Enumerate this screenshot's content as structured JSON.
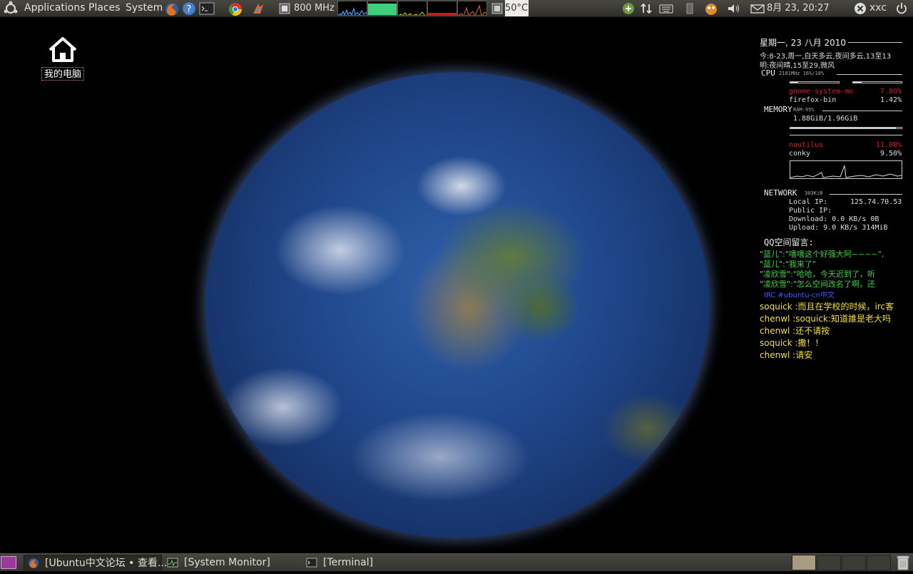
{
  "top_panel": {
    "applications": "Applications",
    "places": "Places",
    "system": "System",
    "cpu_freq": "800 MHz",
    "temperature": "50°C",
    "datetime": "8月 23, 20:27",
    "username": "xxc"
  },
  "desktop": {
    "home_label": "我的电脑"
  },
  "conky": {
    "date": "星期一, 23 八月 2010",
    "weather_line1": "今:8-23,周一,白天多云,夜间多云,13至13",
    "weather_line2": "明:夜间晴,15至29,微风",
    "cpu_label": "CPU",
    "cpu_info": "2101MHz 16%/18%",
    "cpu_procs": [
      {
        "name": "gnome-system-mo",
        "value": "7.80%"
      },
      {
        "name": "firefox-bin",
        "value": "1.42%"
      }
    ],
    "memory_label": "MEMORY",
    "ram_info": "RAM:95%",
    "mem_usage": "1.88GiB/1.96GiB",
    "ram_fraction": 0.95,
    "mem_procs": [
      {
        "name": "nautilus",
        "value": "11.08%"
      },
      {
        "name": "conky",
        "value": "9.50%"
      }
    ],
    "network_label": "NETWORK",
    "network_info": "303KiB",
    "local_ip_label": "Local IP:",
    "local_ip": "125.74.70.53",
    "public_ip_label": "Public IP:",
    "download": "Download: 0.0 KB/s     0B",
    "upload": "Upload: 9.0 KB/s  314MiB",
    "qq_title": "QQ空间留言:",
    "qq_messages": [
      "\"蓝儿\":\"嘻嘻这个好强大阿~~~~\",",
      "\"蓝儿\":\"我来了\"",
      "\"凌欣雪\":\"哈哈，今天迟到了，听",
      "\"凌欣雪\":\"怎么空间改名了啊，还"
    ],
    "irc_title": "IRC #ubuntu-cn中文",
    "irc_messages": [
      "soquick :而且在学校的时候，irc客",
      "chenwl :soquick:知道誰是老大吗",
      "chenwl :还不请按 ",
      "soquick :撒！！ ",
      "chenwl :请安 "
    ]
  },
  "bottom_panel": {
    "tasks": [
      {
        "label": "[Ubuntu中文论坛 • 查看..."
      },
      {
        "label": "[System Monitor]"
      },
      {
        "label": "[Terminal]"
      }
    ]
  }
}
